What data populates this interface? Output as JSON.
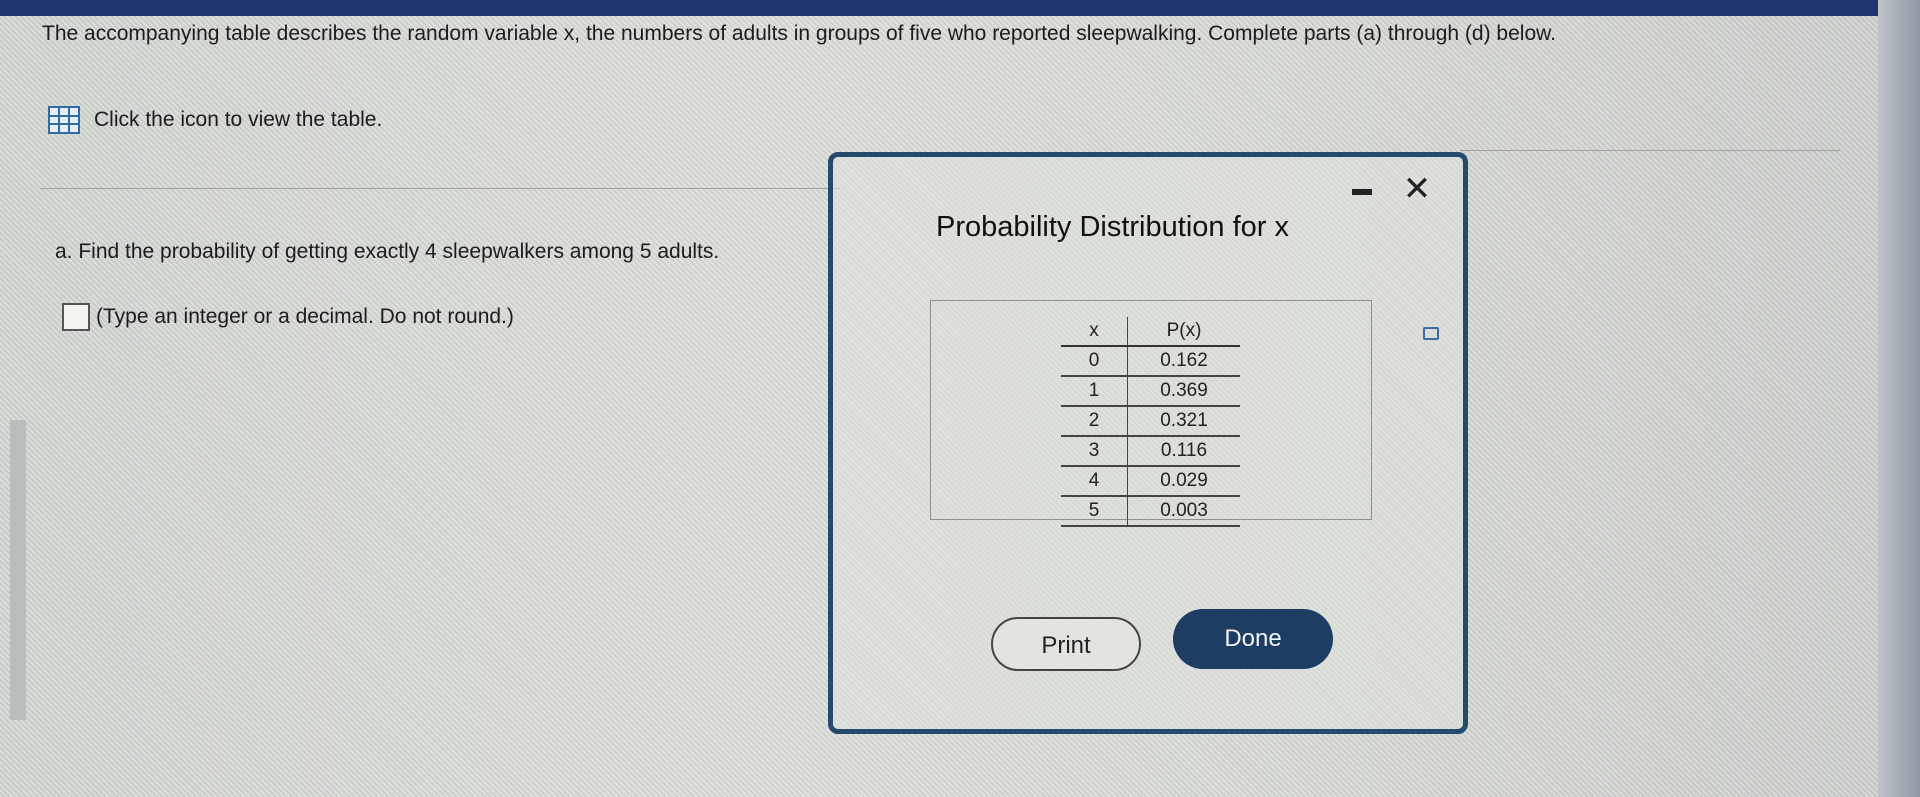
{
  "question": {
    "text": "The accompanying table describes the random variable x, the numbers of adults in groups of five who reported sleepwalking. Complete parts (a) through (d) below."
  },
  "table_link": {
    "icon": "table-grid-icon",
    "label": "Click the icon to view the table."
  },
  "part_a": {
    "prompt": "a. Find the probability of getting exactly 4 sleepwalkers among 5 adults.",
    "hint": "(Type an integer or a decimal. Do not round.)",
    "answer_value": ""
  },
  "dialog": {
    "title": "Probability Distribution for x",
    "minimize_icon": "minimize-icon",
    "close_icon": "close-icon",
    "close_glyph": "✕",
    "copy_icon": "copy-icon",
    "table": {
      "headers": [
        "x",
        "P(x)"
      ],
      "rows": [
        [
          "0",
          "0.162"
        ],
        [
          "1",
          "0.369"
        ],
        [
          "2",
          "0.321"
        ],
        [
          "3",
          "0.116"
        ],
        [
          "4",
          "0.029"
        ],
        [
          "5",
          "0.003"
        ]
      ]
    },
    "print_label": "Print",
    "done_label": "Done"
  },
  "colors": {
    "topbar": "#1d3570",
    "dialog_border": "#254a6e",
    "done_button": "#1e3d63",
    "table_icon": "#2e6da3"
  }
}
